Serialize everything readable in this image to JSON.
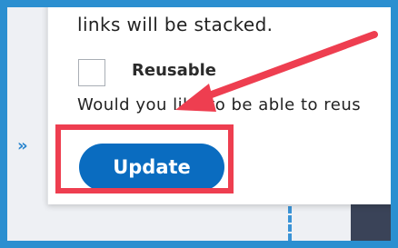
{
  "panel": {
    "help_text_top": "links will be stacked.",
    "reusable_label": "Reusable",
    "reusable_checked": false,
    "help_text_reusable": "Would you like to be able to reus"
  },
  "actions": {
    "update_label": "Update"
  },
  "sidebar": {
    "expand_toggle": "»"
  },
  "annotation": {
    "highlight_color": "#ee3e50",
    "arrow_color": "#ee3e50"
  },
  "colors": {
    "frame_border": "#2b8fd0",
    "button_bg": "#0a6cc0",
    "accent": "#2b86cf"
  }
}
